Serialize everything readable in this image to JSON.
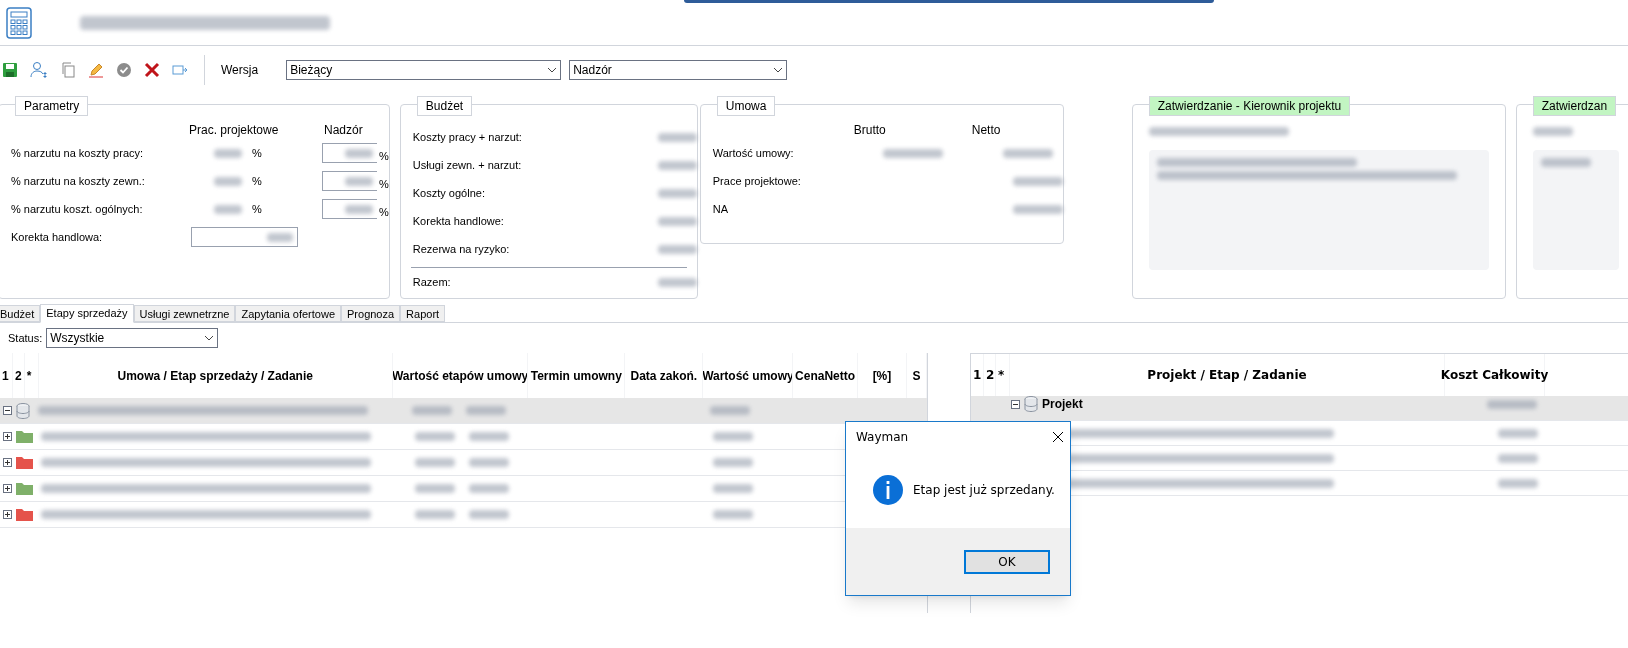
{
  "toolbar": {
    "version_label": "Wersja",
    "version_value": "Bieżący",
    "mode_value": "Nadzór"
  },
  "parametry": {
    "title": "Parametry",
    "col_headers": [
      "Prac. projektowe",
      "Nadzór"
    ],
    "rows": [
      {
        "label": "% narzutu na koszty pracy:",
        "unit": "%",
        "unit2": "%"
      },
      {
        "label": "% narzutu na koszty zewn.:",
        "unit": "%",
        "unit2": "%"
      },
      {
        "label": "% narzutu koszt. ogólnych:",
        "unit": "%",
        "unit2": "%"
      }
    ],
    "korekta_label": "Korekta handlowa:"
  },
  "budzet": {
    "title": "Budżet",
    "rows": [
      "Koszty pracy + narzut:",
      "Usługi zewn. + narzut:",
      "Koszty ogólne:",
      "Korekta handlowe:",
      "Rezerwa na ryzyko:"
    ],
    "total_label": "Razem:"
  },
  "umowa": {
    "title": "Umowa",
    "col_headers": [
      "Brutto",
      "Netto"
    ],
    "rows": [
      "Wartość umowy:",
      "Prace projektowe:",
      "NA"
    ]
  },
  "approvals": [
    {
      "title": "Zatwierdzanie - Kierownik projektu"
    },
    {
      "title": "Zatwierdzan"
    }
  ],
  "tabs": [
    {
      "label": "Budżet",
      "selected": false
    },
    {
      "label": "Etapy sprzedaży",
      "selected": true
    },
    {
      "label": "Usługi zewnetrzne",
      "selected": false
    },
    {
      "label": "Zapytania ofertowe",
      "selected": false
    },
    {
      "label": "Prognoza",
      "selected": false
    },
    {
      "label": "Raport",
      "selected": false
    }
  ],
  "status_filter": {
    "label": "Status:",
    "value": "Wszystkie"
  },
  "left_grid": {
    "columns": [
      "1",
      "2",
      "*",
      "Umowa / Etap sprzedaży / Zadanie",
      "Wartość etapów umowy",
      "Termin umowny",
      "Data zakoń.",
      "Wartość umowy",
      "CenaNetto",
      "[%]",
      "S"
    ],
    "rows": [
      {
        "kind": "root",
        "expanded": true,
        "selected": true
      },
      {
        "kind": "stage",
        "expanded": false,
        "selected": false,
        "color": "#7fb069"
      },
      {
        "kind": "stage",
        "expanded": false,
        "selected": false,
        "color": "#e5534b"
      },
      {
        "kind": "stage",
        "expanded": false,
        "selected": false,
        "color": "#7fb069"
      },
      {
        "kind": "stage",
        "expanded": false,
        "selected": false,
        "color": "#e5534b"
      }
    ]
  },
  "right_grid": {
    "columns": [
      "1",
      "2",
      "*",
      "Projekt / Etap / Zadanie",
      "Koszt Całkowity"
    ],
    "rows": [
      {
        "kind": "root",
        "expanded": true,
        "selected": true,
        "label": "Projekt"
      },
      {
        "kind": "item",
        "selected": false
      },
      {
        "kind": "item",
        "selected": false
      },
      {
        "kind": "item",
        "selected": false
      }
    ]
  },
  "dialog": {
    "title": "Wayman",
    "message": "Etap jest już sprzedany.",
    "button": "OK"
  }
}
